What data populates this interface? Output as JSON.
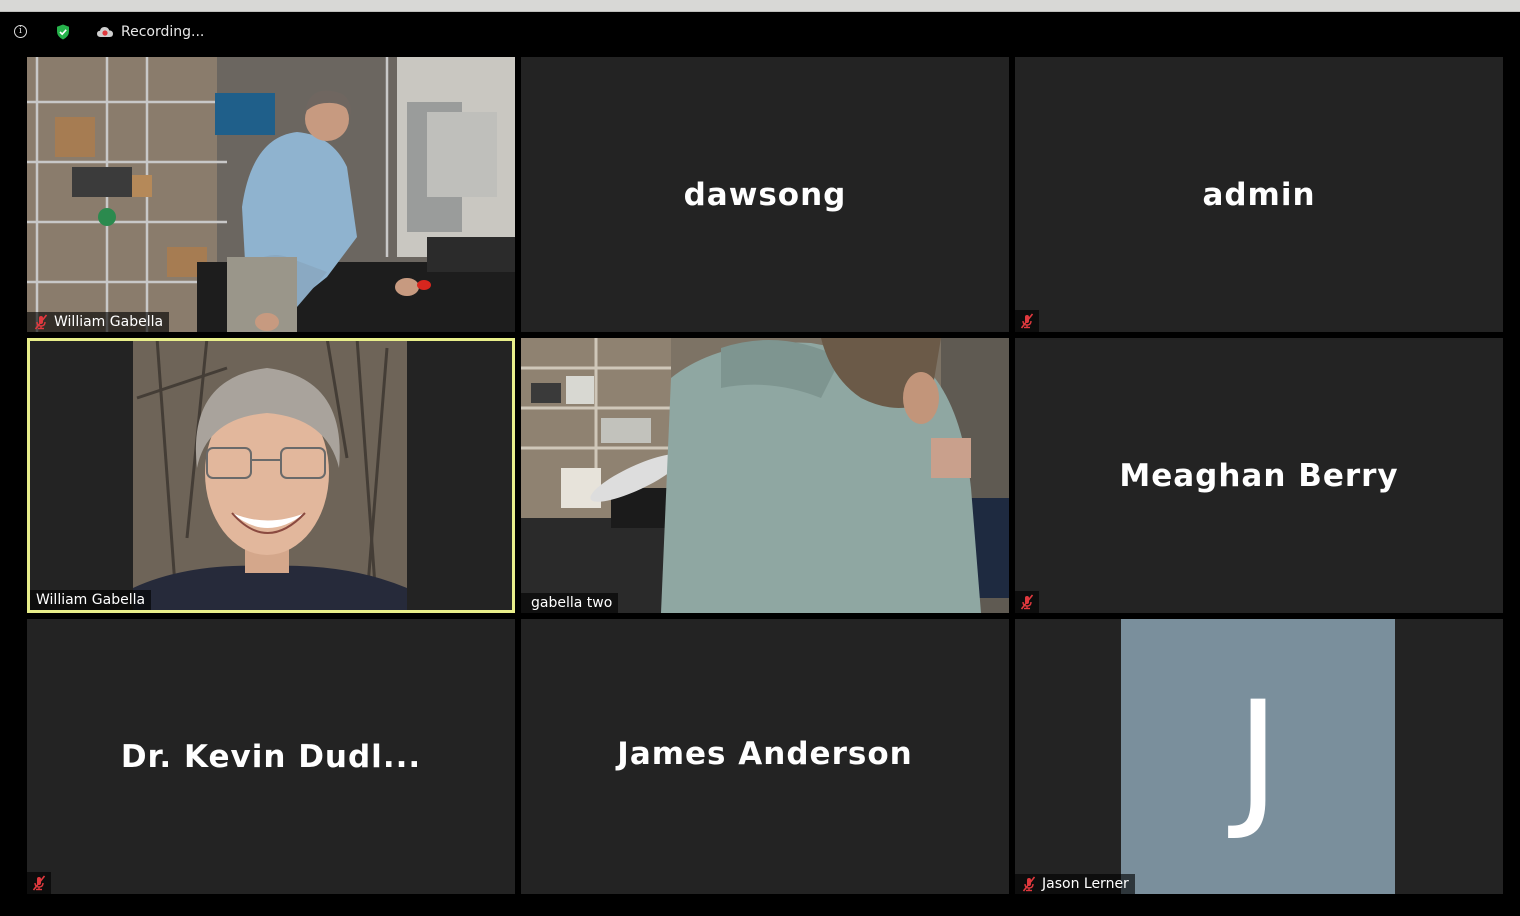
{
  "infobar": {
    "info_icon": "info-icon",
    "shield_icon": "shield-check-icon",
    "recording_icon": "cloud-recording-icon",
    "recording_text": "Recording..."
  },
  "colors": {
    "tile_bg": "#232323",
    "active_speaker_border": "#e8ee8a",
    "mute_red": "#e0393e",
    "shield_green": "#26b24b",
    "avatar_bg": "#7a8f9c"
  },
  "tiles": [
    {
      "name": "William Gabella",
      "type": "video",
      "muted": true,
      "active": false
    },
    {
      "name": "dawsong",
      "type": "name",
      "muted": false,
      "active": false
    },
    {
      "name": "admin",
      "type": "name",
      "muted": true,
      "active": false
    },
    {
      "name": "William Gabella",
      "type": "video",
      "muted": false,
      "active": true
    },
    {
      "name": "gabella two",
      "type": "video",
      "muted": false,
      "active": false
    },
    {
      "name": "Meaghan Berry",
      "type": "name",
      "muted": true,
      "active": false
    },
    {
      "name": "Dr. Kevin Dudl...",
      "type": "name",
      "muted": true,
      "active": false
    },
    {
      "name": "James Anderson",
      "type": "name",
      "muted": false,
      "active": false
    },
    {
      "name": "Jason Lerner",
      "type": "avatar",
      "avatar_initial": "J",
      "muted": true,
      "active": false
    }
  ]
}
